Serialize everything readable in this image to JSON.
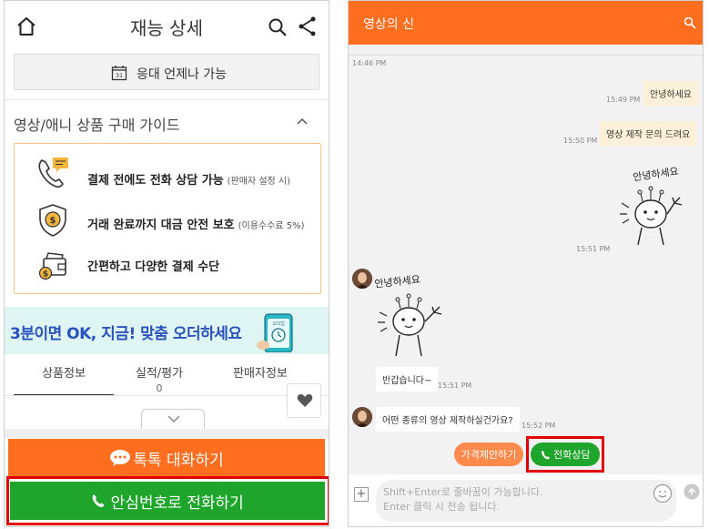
{
  "left": {
    "header": {
      "title": "재능 상세"
    },
    "availability": {
      "label": "응대 언제나 가능"
    },
    "guide": {
      "title": "영상/애니 상품 구매 가이드",
      "items": [
        {
          "text": "결제 전에도 전화 상담 가능",
          "sub": "(판매자 설정 시)"
        },
        {
          "text": "거래 완료까지 대금 안전 보호",
          "sub": "(이용수수료 5%)"
        },
        {
          "text": "간편하고 다양한 결제 수단",
          "sub": ""
        }
      ]
    },
    "banner": {
      "text": "3분이면 OK, 지금! 맞춤 오더하세요",
      "phone_label": "오더업"
    },
    "tabs": [
      {
        "label": "상품정보",
        "sub": ""
      },
      {
        "label": "실적/평가",
        "sub": "0"
      },
      {
        "label": "판매자정보",
        "sub": ""
      }
    ],
    "chat_button": "톡톡 대화하기",
    "call_button": "안심번호로 전화하기"
  },
  "right": {
    "header": {
      "title": "영상의 신"
    },
    "messages": {
      "t0": "14:46 PM",
      "m1": {
        "text": "안녕하세요",
        "time": "15:49 PM"
      },
      "m2": {
        "text": "영상 제작 문의 드려요",
        "time": "15:50 PM"
      },
      "s1": {
        "caption": "안녕하세요",
        "time": "15:51 PM"
      },
      "s2": {
        "caption": "안녕하세요"
      },
      "m3": {
        "text": "반갑습니다~",
        "time": "15:51 PM"
      },
      "m4": {
        "text": "어떤 종류의 영상 제작하실건가요?",
        "time": "15:52 PM"
      }
    },
    "actions": {
      "price": "가격제안하기",
      "call": "전화상담"
    },
    "input": {
      "placeholder": "Shift+Enter로 줄바꿈이 가능합니다.\nEnter 클릭 시 전송 됩니다."
    }
  }
}
